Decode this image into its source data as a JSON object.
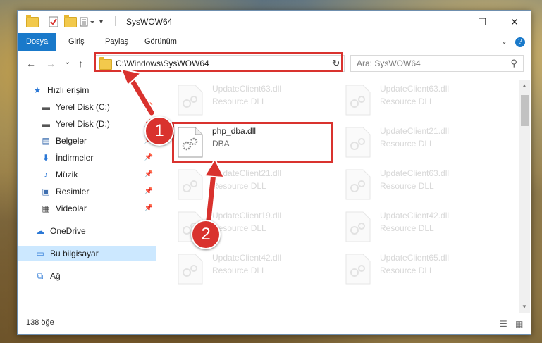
{
  "window": {
    "title": "SysWOW64",
    "minimize_glyph": "—",
    "maximize_glyph": "☐",
    "close_glyph": "✕"
  },
  "ribbon": {
    "tabs": [
      "Dosya",
      "Giriş",
      "Paylaş",
      "Görünüm"
    ],
    "expand_glyph": "⌄",
    "help_glyph": "?"
  },
  "nav": {
    "back_glyph": "←",
    "forward_glyph": "→",
    "recent_glyph": "⌄",
    "up_glyph": "↑",
    "address": "C:\\Windows\\SysWOW64",
    "address_dropdown_glyph": "⌄",
    "refresh_glyph": "↻",
    "search_placeholder": "Ara: SysWOW64",
    "search_glyph": "⚲"
  },
  "sidebar": {
    "items": [
      {
        "label": "Hızlı erişim",
        "icon": "star-icon",
        "glyph": "★",
        "color": "#2b78d6",
        "pinned": false
      },
      {
        "label": "Yerel Disk (C:)",
        "icon": "drive-icon",
        "glyph": "▬",
        "color": "#555555",
        "pinned": true
      },
      {
        "label": "Yerel Disk (D:)",
        "icon": "drive-icon",
        "glyph": "▬",
        "color": "#555555",
        "pinned": true
      },
      {
        "label": "Belgeler",
        "icon": "documents-icon",
        "glyph": "▤",
        "color": "#3f6fb0",
        "pinned": true
      },
      {
        "label": "İndirmeler",
        "icon": "download-icon",
        "glyph": "⬇",
        "color": "#2b78d6",
        "pinned": true
      },
      {
        "label": "Müzik",
        "icon": "music-icon",
        "glyph": "♪",
        "color": "#2b78d6",
        "pinned": true
      },
      {
        "label": "Resimler",
        "icon": "pictures-icon",
        "glyph": "▣",
        "color": "#3f6fb0",
        "pinned": true
      },
      {
        "label": "Videolar",
        "icon": "videos-icon",
        "glyph": "▦",
        "color": "#444444",
        "pinned": true
      },
      {
        "label": "OneDrive",
        "icon": "cloud-icon",
        "glyph": "☁",
        "color": "#2b78d6",
        "pinned": false
      },
      {
        "label": "Bu bilgisayar",
        "icon": "computer-icon",
        "glyph": "▭",
        "color": "#2b78d6",
        "pinned": false,
        "selected": true
      },
      {
        "label": "Ağ",
        "icon": "network-icon",
        "glyph": "⧉",
        "color": "#2b78d6",
        "pinned": false
      }
    ],
    "pin_glyph": "📌"
  },
  "files": {
    "selected": {
      "name": "php_dba.dll",
      "desc": "DBA"
    },
    "ghosts": [
      {
        "name": "UpdateClient63.dll",
        "desc": "Resource DLL"
      },
      {
        "name": "UpdateClient63.dll",
        "desc": "Resource DLL"
      },
      {
        "name": "UpdateClient21.dll",
        "desc": "Resource DLL"
      },
      {
        "name": "UpdateClient21.dll",
        "desc": "Resource DLL"
      },
      {
        "name": "UpdateClient63.dll",
        "desc": "Resource DLL"
      },
      {
        "name": "UpdateClient19.dll",
        "desc": "Resource DLL"
      },
      {
        "name": "UpdateClient42.dll",
        "desc": "Resource DLL"
      },
      {
        "name": "UpdateClient42.dll",
        "desc": "Resource DLL"
      },
      {
        "name": "UpdateClient65.dll",
        "desc": "Resource DLL"
      }
    ]
  },
  "status": {
    "count": "138 öğe"
  },
  "annotations": {
    "step1": "1",
    "step2": "2",
    "color": "#d9322e"
  }
}
